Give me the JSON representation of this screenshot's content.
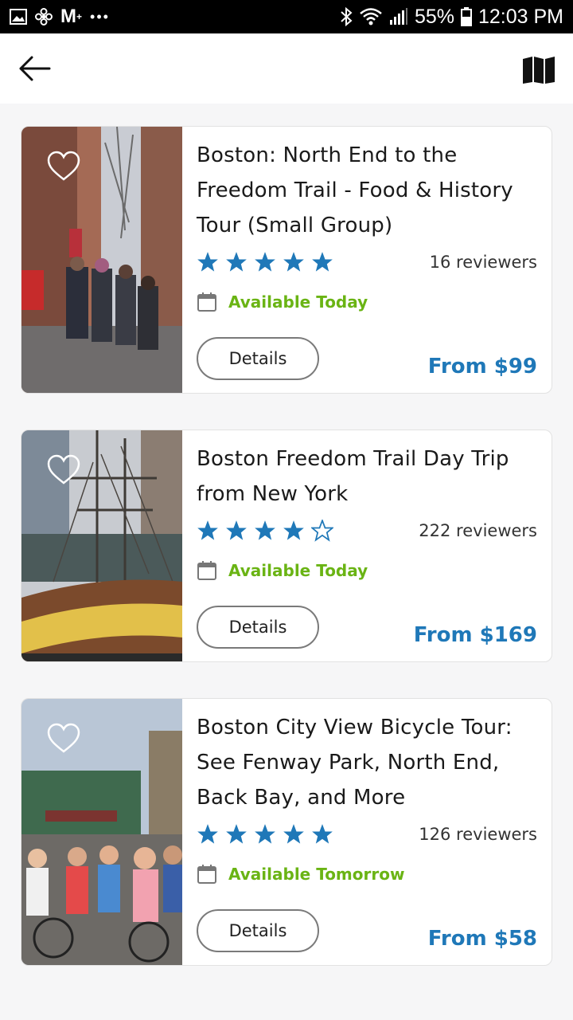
{
  "status_bar": {
    "battery": "55%",
    "time": "12:03 PM",
    "icons": [
      "gallery-icon",
      "fan-icon",
      "gmail-icon",
      "more-icon",
      "bluetooth-icon",
      "wifi-icon",
      "signal-icon",
      "battery-icon"
    ]
  },
  "header": {
    "back_icon": "arrow-left-icon",
    "map_icon": "map-icon"
  },
  "colors": {
    "accent_blue": "#1f78b8",
    "star_blue": "#1f78b8",
    "available_green": "#6ab414"
  },
  "tours": [
    {
      "title": "Boston: North End to the Freedom Trail - Food & History Tour (Small Group)",
      "rating": 5,
      "reviewers": "16 reviewers",
      "availability": "Available Today",
      "details_label": "Details",
      "price": "From $99"
    },
    {
      "title": "Boston Freedom Trail Day Trip from New York",
      "rating": 4,
      "reviewers": "222 reviewers",
      "availability": "Available Today",
      "details_label": "Details",
      "price": "From $169"
    },
    {
      "title": "Boston City View Bicycle Tour: See Fenway Park, North End, Back Bay, and More",
      "rating": 5,
      "reviewers": "126 reviewers",
      "availability": "Available Tomorrow",
      "details_label": "Details",
      "price": "From $58"
    }
  ]
}
